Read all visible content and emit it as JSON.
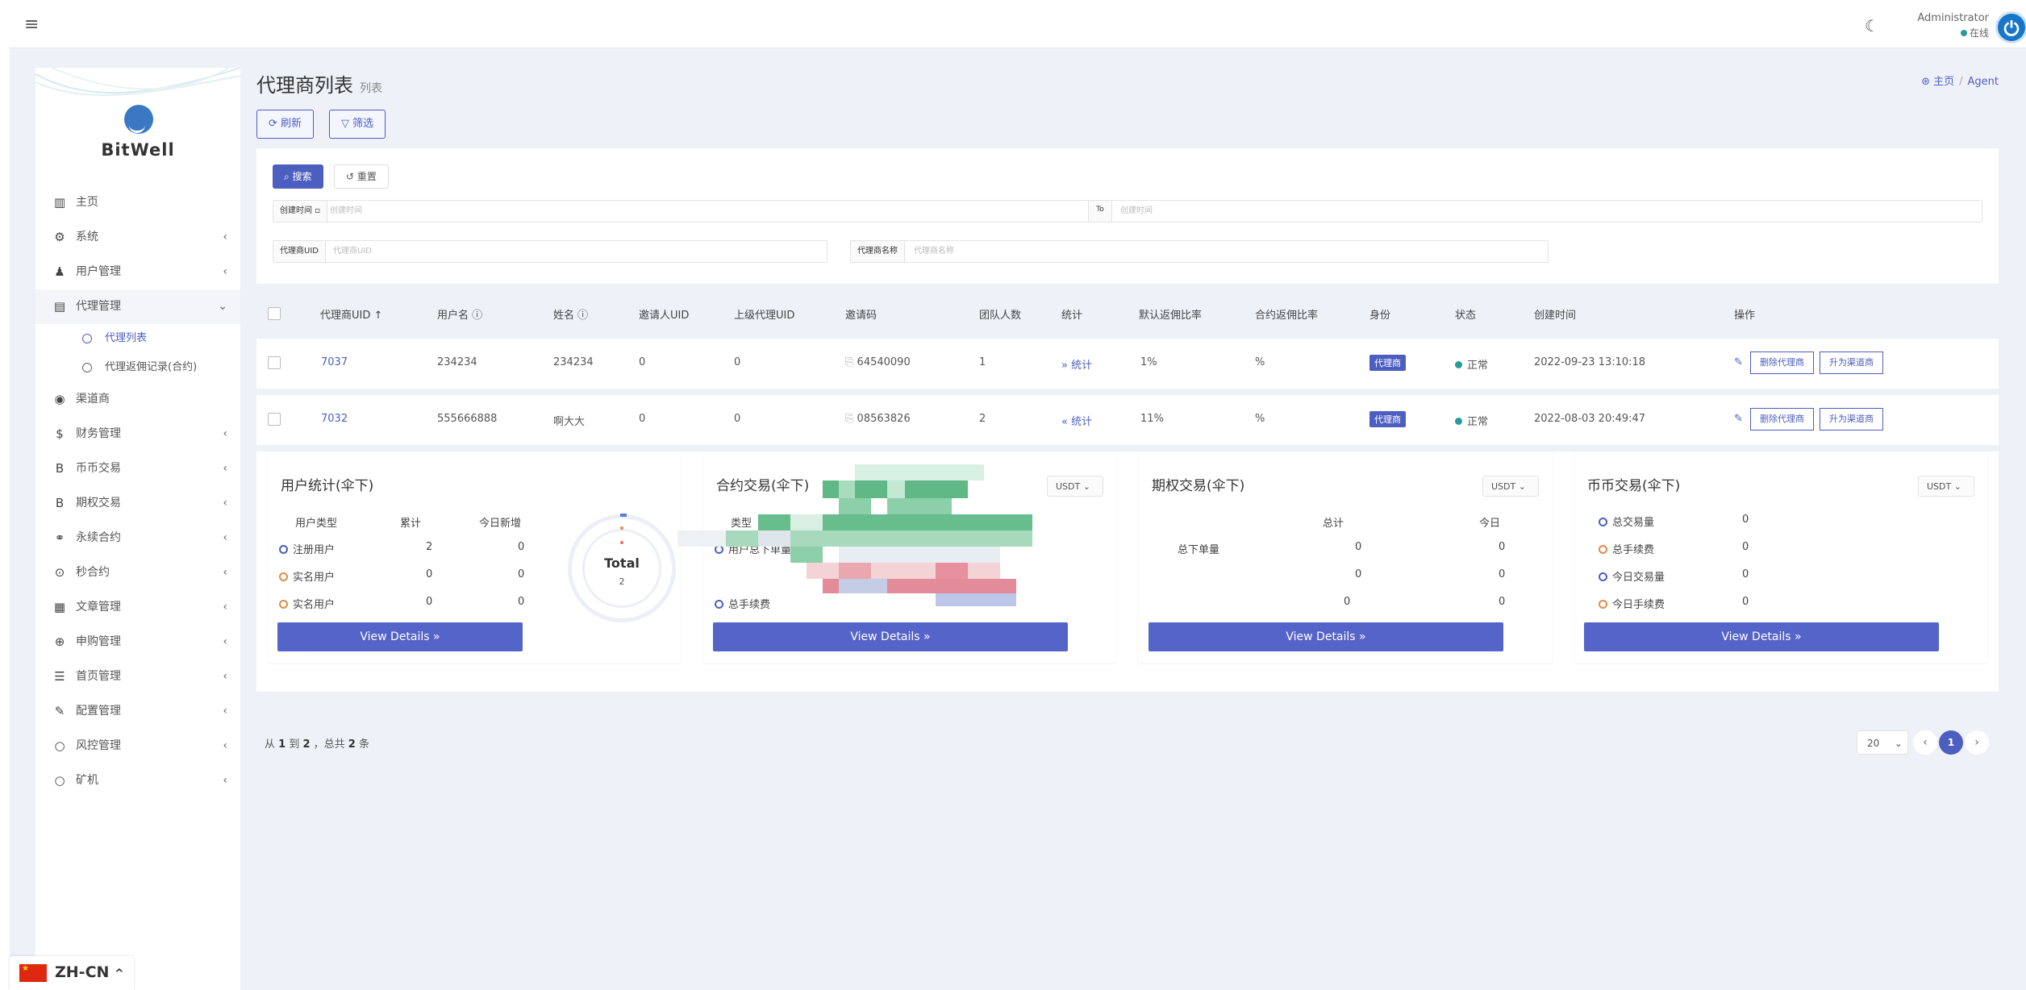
{
  "topbar": {
    "admin_name": "Administrator",
    "status": "在线"
  },
  "sidebar": {
    "brand": "BitWell",
    "items": [
      {
        "label": "主页"
      },
      {
        "label": "系统"
      },
      {
        "label": "用户管理"
      },
      {
        "label": "代理管理"
      },
      {
        "label": "代理列表"
      },
      {
        "label": "代理返佣记录(合约)"
      },
      {
        "label": "渠道商"
      },
      {
        "label": "财务管理"
      },
      {
        "label": "币币交易"
      },
      {
        "label": "期权交易"
      },
      {
        "label": "永续合约"
      },
      {
        "label": "秒合约"
      },
      {
        "label": "文章管理"
      },
      {
        "label": "申购管理"
      },
      {
        "label": "首页管理"
      },
      {
        "label": "配置管理"
      },
      {
        "label": "风控管理"
      },
      {
        "label": "矿机"
      }
    ]
  },
  "lang": {
    "label": "ZH-CN"
  },
  "page": {
    "title": "代理商列表",
    "subtitle": "列表"
  },
  "breadcrumb": {
    "home": "主页",
    "current": "Agent"
  },
  "toolbar": {
    "refresh": "刷新",
    "filter": "筛选"
  },
  "filter": {
    "search": "搜索",
    "reset": "重置",
    "created_label": "创建时间",
    "created_ph": "创建时间",
    "to": "To",
    "created_to_ph": "创建时间",
    "uid_label": "代理商UID",
    "uid_ph": "代理商UID",
    "name_label": "代理商名称",
    "name_ph": "代理商名称"
  },
  "table": {
    "headers": [
      "代理商UID",
      "用户名",
      "姓名",
      "邀请人UID",
      "上级代理UID",
      "邀请码",
      "团队人数",
      "统计",
      "默认返佣比率",
      "合约返佣比率",
      "身份",
      "状态",
      "创建时间",
      "操作"
    ],
    "rows": [
      {
        "uid": "7037",
        "username": "234234",
        "name": "234234",
        "inviter": "0",
        "parent": "0",
        "code": "64540090",
        "team": "1",
        "stat": "统计",
        "rate": "1%",
        "crate": "%",
        "role": "代理商",
        "status": "正常",
        "created": "2022-09-23 13:10:18",
        "del": "删除代理商",
        "up": "升为渠道商"
      },
      {
        "uid": "7032",
        "username": "555666888",
        "name": "啊大大",
        "inviter": "0",
        "parent": "0",
        "code": "08563826",
        "team": "2",
        "stat": "统计",
        "rate": "11%",
        "crate": "%",
        "role": "代理商",
        "status": "正常",
        "created": "2022-08-03 20:49:47",
        "del": "删除代理商",
        "up": "升为渠道商"
      }
    ]
  },
  "cards": {
    "user": {
      "title": "用户统计(伞下)",
      "h1": "用户类型",
      "h2": "累计",
      "h3": "今日新增",
      "rows": [
        {
          "label": "注册用户",
          "total": "2",
          "today": "0"
        },
        {
          "label": "实名用户",
          "total": "0",
          "today": "0"
        },
        {
          "label": "实名用户",
          "total": "0",
          "today": "0"
        }
      ],
      "donut_label": "Total",
      "donut_value": "2",
      "btn": "View Details »"
    },
    "contract": {
      "title": "合约交易(伞下)",
      "currency": "USDT",
      "h1": "类型",
      "r1": "用户总下单量",
      "r2": "总手续费",
      "btn": "View Details »"
    },
    "option": {
      "title": "期权交易(伞下)",
      "currency": "USDT",
      "h2": "总计",
      "h3": "今日",
      "r1": "总下单量",
      "rows": [
        {
          "total": "0",
          "today": "0"
        },
        {
          "total": "0",
          "today": "0"
        },
        {
          "total": "0",
          "today": "0"
        }
      ],
      "btn": "View Details »"
    },
    "spot": {
      "title": "币币交易(伞下)",
      "currency": "USDT",
      "rows": [
        {
          "label": "总交易量",
          "value": "0"
        },
        {
          "label": "总手续费",
          "value": "0"
        },
        {
          "label": "今日交易量",
          "value": "0"
        },
        {
          "label": "今日手续费",
          "value": "0"
        }
      ],
      "btn": "View Details »"
    }
  },
  "pager": {
    "from": "1",
    "to": "2",
    "total": "2",
    "size": "20",
    "page": "1"
  },
  "colors": {
    "accent": "#4d5ec1",
    "status": "#2b9a9a"
  }
}
